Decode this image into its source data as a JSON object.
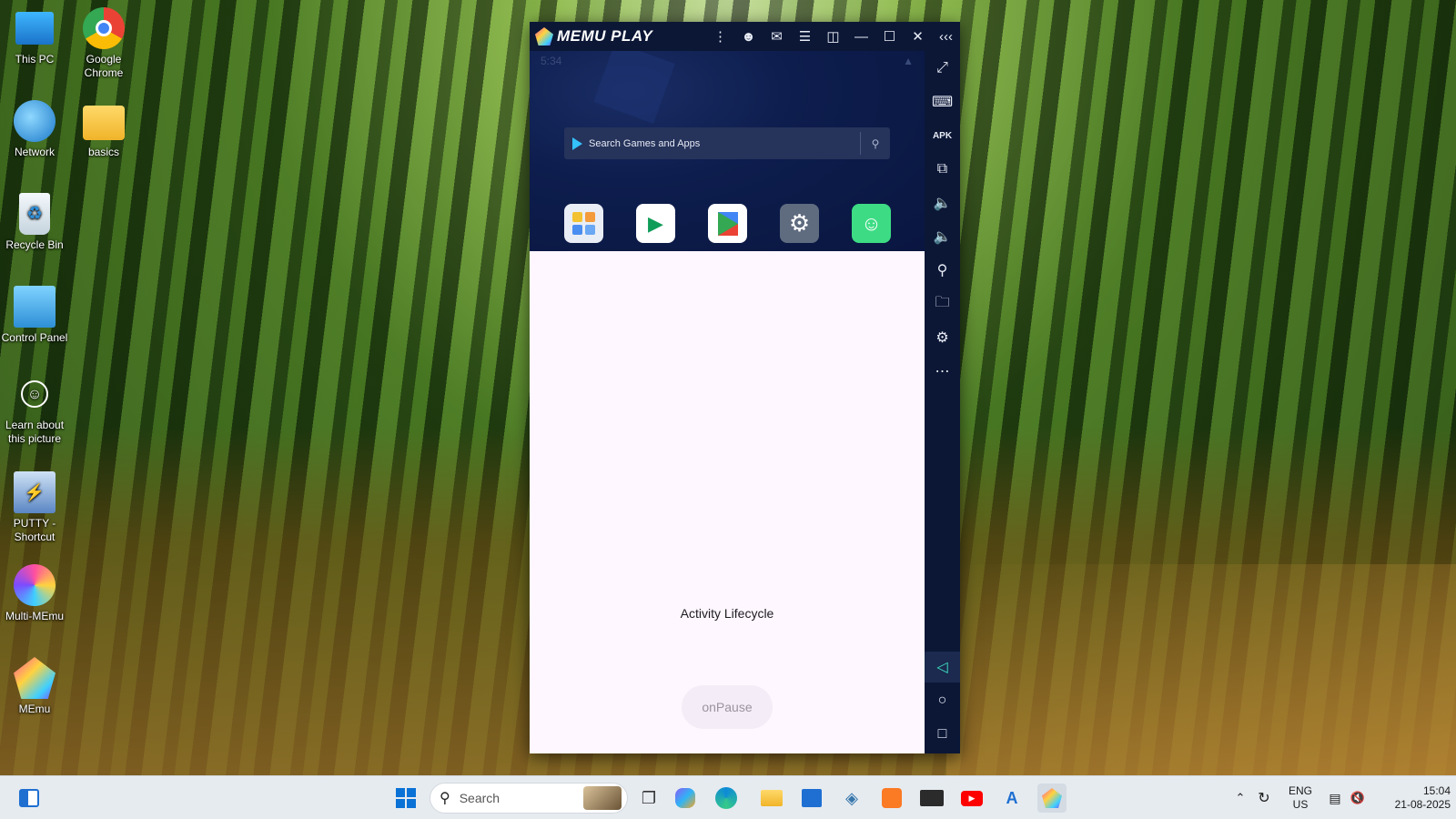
{
  "desktop": {
    "icons": [
      {
        "label": "This PC",
        "icon": "monitor-icon"
      },
      {
        "label": "Google Chrome",
        "icon": "chrome-icon"
      },
      {
        "label": "Network",
        "icon": "network-icon"
      },
      {
        "label": "basics",
        "icon": "folder-icon"
      },
      {
        "label": "Recycle Bin",
        "icon": "recycle-bin-icon"
      },
      {
        "label": "Control Panel",
        "icon": "control-panel-icon"
      },
      {
        "label": "Learn about this picture",
        "icon": "learn-picture-icon"
      },
      {
        "label": "PUTTY - Shortcut",
        "icon": "putty-icon"
      },
      {
        "label": "Multi-MEmu",
        "icon": "multi-memu-icon"
      },
      {
        "label": "MEmu",
        "icon": "memu-icon"
      }
    ]
  },
  "memu": {
    "brand": "MEMU PLAY",
    "title_buttons": [
      "menu-dots-icon",
      "account-icon",
      "mail-icon",
      "hamburger-icon",
      "screen-cast-icon",
      "minimize-icon",
      "maximize-icon",
      "close-icon",
      "collapse-icon"
    ],
    "status_time": "5:34",
    "search_placeholder": "Search Games and Apps",
    "apps": [
      {
        "label": "Tools",
        "icon": "tools-folder-icon"
      },
      {
        "label": "Play Games",
        "icon": "play-games-icon"
      },
      {
        "label": "Play Store",
        "icon": "play-store-icon"
      },
      {
        "label": "Settings",
        "icon": "settings-icon"
      },
      {
        "label": "My Application",
        "icon": "android-icon"
      }
    ],
    "activity": {
      "title": "Activity Lifecycle",
      "button": "onPause"
    },
    "sidebar": [
      "fullscreen-icon",
      "keyboard-icon",
      "apk-icon",
      "multi-window-icon",
      "volume-up-icon",
      "volume-down-icon",
      "location-icon",
      "folder-icon",
      "settings-gear-icon",
      "more-icon",
      "back-icon",
      "home-icon",
      "recents-icon"
    ]
  },
  "taskbar": {
    "search_placeholder": "Search",
    "language": "ENG",
    "region": "US",
    "time": "15:04",
    "date": "21-08-2025"
  }
}
